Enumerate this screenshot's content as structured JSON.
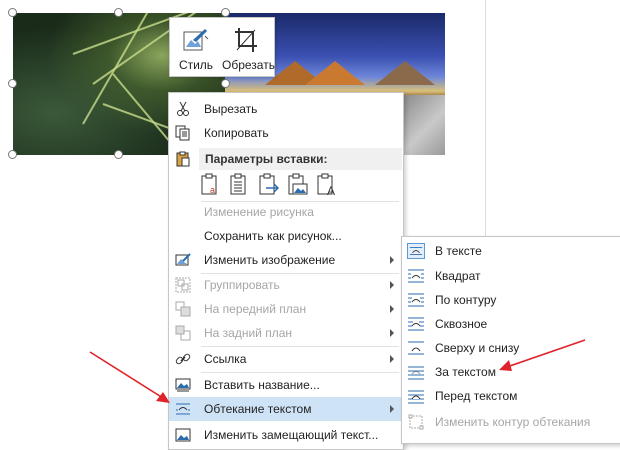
{
  "mini_toolbar": {
    "style_label": "Стиль",
    "crop_label": "Обрезать"
  },
  "context_menu": {
    "cut": "Вырезать",
    "copy": "Копировать",
    "paste_options_header": "Параметры вставки:",
    "change_picture": "Изменение рисунка",
    "save_as_picture": "Сохранить как рисунок...",
    "edit_image": "Изменить изображение",
    "group": "Группировать",
    "bring_forward": "На передний план",
    "send_backward": "На задний план",
    "link": "Ссылка",
    "insert_caption": "Вставить название...",
    "wrap_text": "Обтекание текстом",
    "edit_alt_text": "Изменить замещающий текст..."
  },
  "wrap_submenu": {
    "in_line": "В тексте",
    "square": "Квадрат",
    "tight": "По контуру",
    "through": "Сквозное",
    "top_bottom": "Сверху и снизу",
    "behind_text": "За текстом",
    "in_front": "Перед текстом",
    "edit_wrap_points": "Изменить контур обтекания"
  },
  "colors": {
    "highlight": "#cfe3f7",
    "annotation_arrow": "#e0232a",
    "icon_blue": "#2b6cb0"
  }
}
